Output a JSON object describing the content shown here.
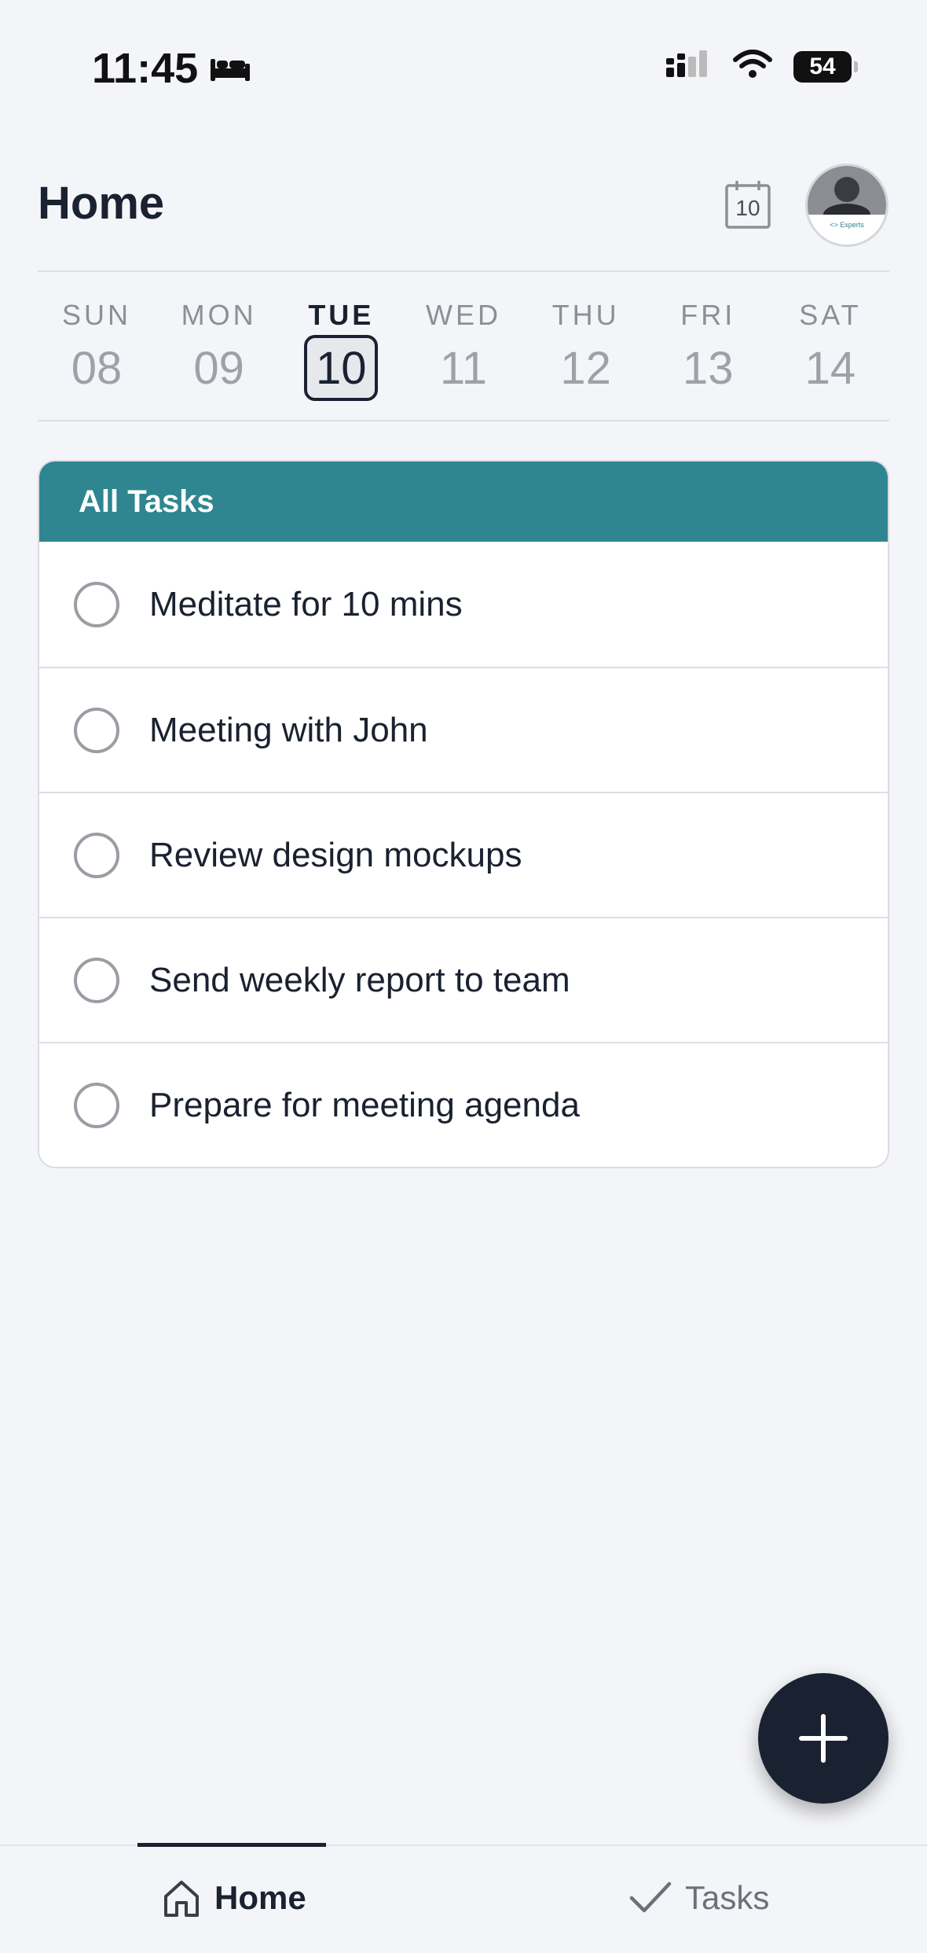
{
  "status_bar": {
    "time": "11:45",
    "sleep_icon": "bed-icon",
    "battery": "54"
  },
  "header": {
    "title": "Home",
    "calendar_day": "10",
    "calendar_icon": "calendar-icon",
    "avatar_icon": "user-avatar"
  },
  "week": {
    "days": [
      {
        "name": "SUN",
        "num": "08"
      },
      {
        "name": "MON",
        "num": "09"
      },
      {
        "name": "TUE",
        "num": "10"
      },
      {
        "name": "WED",
        "num": "11"
      },
      {
        "name": "THU",
        "num": "12"
      },
      {
        "name": "FRI",
        "num": "13"
      },
      {
        "name": "SAT",
        "num": "14"
      }
    ],
    "selected_index": 2
  },
  "tasks": {
    "header": "All Tasks",
    "accent_color": "#2f8690",
    "items": [
      {
        "label": "Meditate for 10 mins",
        "done": false
      },
      {
        "label": "Meeting with John",
        "done": false
      },
      {
        "label": "Review design mockups",
        "done": false
      },
      {
        "label": "Send weekly report to team",
        "done": false
      },
      {
        "label": "Prepare for meeting agenda",
        "done": false
      }
    ]
  },
  "fab": {
    "icon": "plus-icon"
  },
  "tab_bar": {
    "home_label": "Home",
    "tasks_label": "Tasks",
    "active": "home"
  }
}
